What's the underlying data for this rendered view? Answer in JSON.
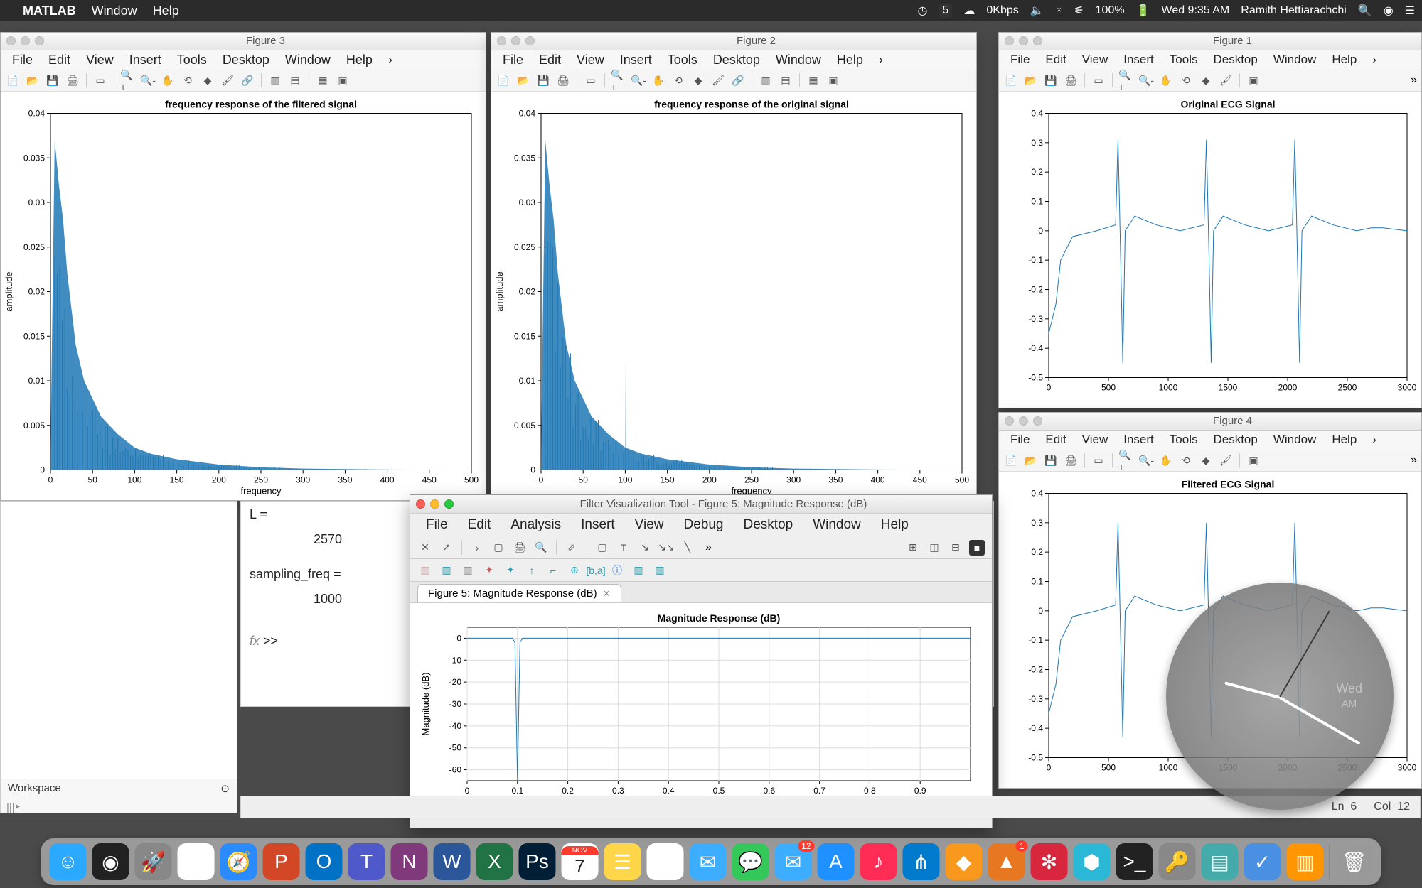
{
  "mac_menubar": {
    "app": "MATLAB",
    "items": [
      "Window",
      "Help"
    ],
    "right": {
      "net": "0Kbps",
      "battery": "100%",
      "clock": "Wed 9:35 AM",
      "user": "Ramith Hettiarachchi",
      "shield": "5"
    }
  },
  "figures": {
    "f3": {
      "title": "Figure 3",
      "menu": [
        "File",
        "Edit",
        "View",
        "Insert",
        "Tools",
        "Desktop",
        "Window",
        "Help"
      ]
    },
    "f2": {
      "title": "Figure 2",
      "menu": [
        "File",
        "Edit",
        "View",
        "Insert",
        "Tools",
        "Desktop",
        "Window",
        "Help"
      ]
    },
    "f1": {
      "title": "Figure 1",
      "menu": [
        "File",
        "Edit",
        "View",
        "Insert",
        "Tools",
        "Desktop",
        "Window",
        "Help"
      ]
    },
    "f4": {
      "title": "Figure 4",
      "menu": [
        "File",
        "Edit",
        "View",
        "Insert",
        "Tools",
        "Desktop",
        "Window",
        "Help"
      ]
    }
  },
  "fvt": {
    "title": "Filter Visualization Tool - Figure 5: Magnitude Response (dB)",
    "menu": [
      "File",
      "Edit",
      "Analysis",
      "Insert",
      "View",
      "Debug",
      "Desktop",
      "Window",
      "Help"
    ],
    "tab": "Figure 5: Magnitude Response (dB)"
  },
  "cmd": {
    "l_label": "L =",
    "l_val": "2570",
    "sf_label": "sampling_freq =",
    "sf_val": "1000",
    "prompt": ">>",
    "fx": "fx"
  },
  "workspace": {
    "title": "Workspace"
  },
  "statusbar": {
    "ln": "Ln",
    "ln_v": "6",
    "col": "Col",
    "col_v": "12"
  },
  "clock": {
    "day": "Wed",
    "ampm": "AM"
  },
  "dock": {
    "apps": [
      "finder",
      "siri",
      "launchpad",
      "chrome",
      "safari",
      "powerpoint",
      "outlook",
      "teams",
      "onenote",
      "word",
      "excel",
      "photoshop",
      "calendar",
      "notes",
      "photos",
      "mail",
      "messages",
      "mail2",
      "appstore",
      "music",
      "vscode",
      "idea",
      "matlab",
      "mathematica",
      "3d",
      "terminal",
      "keychain",
      "files",
      "todo",
      "books",
      "trash"
    ],
    "badges": {
      "mail2": "12",
      "matlab": "1"
    },
    "cal_month": "NOV",
    "cal_day": "7"
  },
  "chart_data": [
    {
      "id": "fig3",
      "type": "line",
      "title": "frequency response of the filtered signal",
      "xlabel": "frequency",
      "ylabel": "amplitude",
      "xlim": [
        0,
        500
      ],
      "ylim": [
        0,
        0.04
      ],
      "xticks": [
        0,
        50,
        100,
        150,
        200,
        250,
        300,
        350,
        400,
        450,
        500
      ],
      "yticks": [
        0,
        0.005,
        0.01,
        0.015,
        0.02,
        0.025,
        0.03,
        0.035,
        0.04
      ],
      "series": [
        {
          "name": "filtered",
          "x": [
            0,
            5,
            10,
            15,
            20,
            25,
            30,
            40,
            50,
            60,
            80,
            100,
            120,
            150,
            200,
            250,
            300,
            350,
            400,
            450,
            500
          ],
          "y": [
            0.002,
            0.037,
            0.032,
            0.028,
            0.022,
            0.018,
            0.014,
            0.01,
            0.008,
            0.006,
            0.004,
            0.0025,
            0.0018,
            0.0012,
            0.0006,
            0.0003,
            0.00015,
            0.0001,
            5e-05,
            3e-05,
            2e-05
          ]
        }
      ]
    },
    {
      "id": "fig2",
      "type": "line",
      "title": "frequency response of the original signal",
      "xlabel": "frequency",
      "ylabel": "amplitude",
      "xlim": [
        0,
        500
      ],
      "ylim": [
        0,
        0.04
      ],
      "xticks": [
        0,
        50,
        100,
        150,
        200,
        250,
        300,
        350,
        400,
        450,
        500
      ],
      "yticks": [
        0,
        0.005,
        0.01,
        0.015,
        0.02,
        0.025,
        0.03,
        0.035,
        0.04
      ],
      "series": [
        {
          "name": "orig",
          "x": [
            0,
            5,
            10,
            15,
            20,
            25,
            30,
            40,
            50,
            60,
            80,
            100,
            120,
            150,
            200,
            250,
            300,
            350,
            400,
            450,
            500
          ],
          "y": [
            0.002,
            0.037,
            0.032,
            0.028,
            0.022,
            0.018,
            0.014,
            0.01,
            0.008,
            0.006,
            0.004,
            0.0025,
            0.0018,
            0.0012,
            0.0006,
            0.0003,
            0.00015,
            0.0001,
            5e-05,
            3e-05,
            2e-05
          ]
        },
        {
          "name": "spike",
          "x": [
            100,
            100.5,
            101
          ],
          "y": [
            0,
            0.012,
            0
          ]
        }
      ]
    },
    {
      "id": "fig1",
      "type": "line",
      "title": "Original ECG Signal",
      "xlabel": "",
      "ylabel": "",
      "xlim": [
        0,
        3000
      ],
      "ylim": [
        -0.5,
        0.4
      ],
      "xticks": [
        0,
        500,
        1000,
        1500,
        2000,
        2500,
        3000
      ],
      "yticks": [
        -0.5,
        -0.4,
        -0.3,
        -0.2,
        -0.1,
        0,
        0.1,
        0.2,
        0.3,
        0.4
      ],
      "series": [
        {
          "name": "ecg",
          "x": [
            0,
            60,
            100,
            200,
            400,
            560,
            580,
            600,
            620,
            640,
            720,
            900,
            1100,
            1300,
            1320,
            1340,
            1360,
            1380,
            1460,
            1640,
            1840,
            2040,
            2060,
            2080,
            2100,
            2120,
            2200,
            2380,
            2580,
            2700,
            2800,
            3000
          ],
          "y": [
            -0.35,
            -0.25,
            -0.1,
            -0.02,
            0,
            0.02,
            0.31,
            -0.05,
            -0.45,
            0,
            0.05,
            0.02,
            0,
            0.02,
            0.31,
            -0.05,
            -0.45,
            0,
            0.05,
            0.02,
            0,
            0.02,
            0.31,
            -0.05,
            -0.45,
            0,
            0.05,
            0.02,
            0,
            0.01,
            0.01,
            0
          ]
        }
      ]
    },
    {
      "id": "fig4",
      "type": "line",
      "title": "Filtered ECG Signal",
      "xlabel": "",
      "ylabel": "",
      "xlim": [
        0,
        3000
      ],
      "ylim": [
        -0.5,
        0.4
      ],
      "xticks": [
        0,
        500,
        1000,
        1500,
        2000,
        2500,
        3000
      ],
      "yticks": [
        -0.5,
        -0.4,
        -0.3,
        -0.2,
        -0.1,
        0,
        0.1,
        0.2,
        0.3,
        0.4
      ],
      "series": [
        {
          "name": "ecg",
          "x": [
            0,
            60,
            100,
            200,
            400,
            560,
            580,
            600,
            620,
            640,
            720,
            900,
            1100,
            1300,
            1320,
            1340,
            1360,
            1380,
            1460,
            1640,
            1840,
            2040,
            2060,
            2080,
            2100,
            2120,
            2200,
            2380,
            2580,
            2700,
            2800,
            3000
          ],
          "y": [
            -0.35,
            -0.25,
            -0.1,
            -0.02,
            0,
            0.02,
            0.3,
            -0.05,
            -0.43,
            0,
            0.05,
            0.02,
            0,
            0.02,
            0.3,
            -0.05,
            -0.43,
            0,
            0.05,
            0.02,
            0,
            0.02,
            0.3,
            -0.05,
            -0.43,
            0,
            0.05,
            0.02,
            0,
            0.01,
            0.01,
            0
          ]
        }
      ]
    },
    {
      "id": "fig5",
      "type": "line",
      "title": "Magnitude Response (dB)",
      "xlabel": "",
      "ylabel": "Magnitude (dB)",
      "xlim": [
        0,
        1
      ],
      "ylim": [
        -65,
        5
      ],
      "xticks": [
        0,
        0.1,
        0.2,
        0.3,
        0.4,
        0.5,
        0.6,
        0.7,
        0.8,
        0.9
      ],
      "yticks": [
        -60,
        -50,
        -40,
        -30,
        -20,
        -10,
        0
      ],
      "series": [
        {
          "name": "mag",
          "x": [
            0,
            0.05,
            0.09,
            0.095,
            0.1,
            0.105,
            0.11,
            0.2,
            0.3,
            0.4,
            0.5,
            0.6,
            0.7,
            0.8,
            0.9,
            1.0
          ],
          "y": [
            0,
            0,
            0,
            -2,
            -65,
            -2,
            0,
            0,
            0,
            0,
            0,
            0,
            0,
            0,
            0,
            0
          ]
        }
      ]
    }
  ]
}
